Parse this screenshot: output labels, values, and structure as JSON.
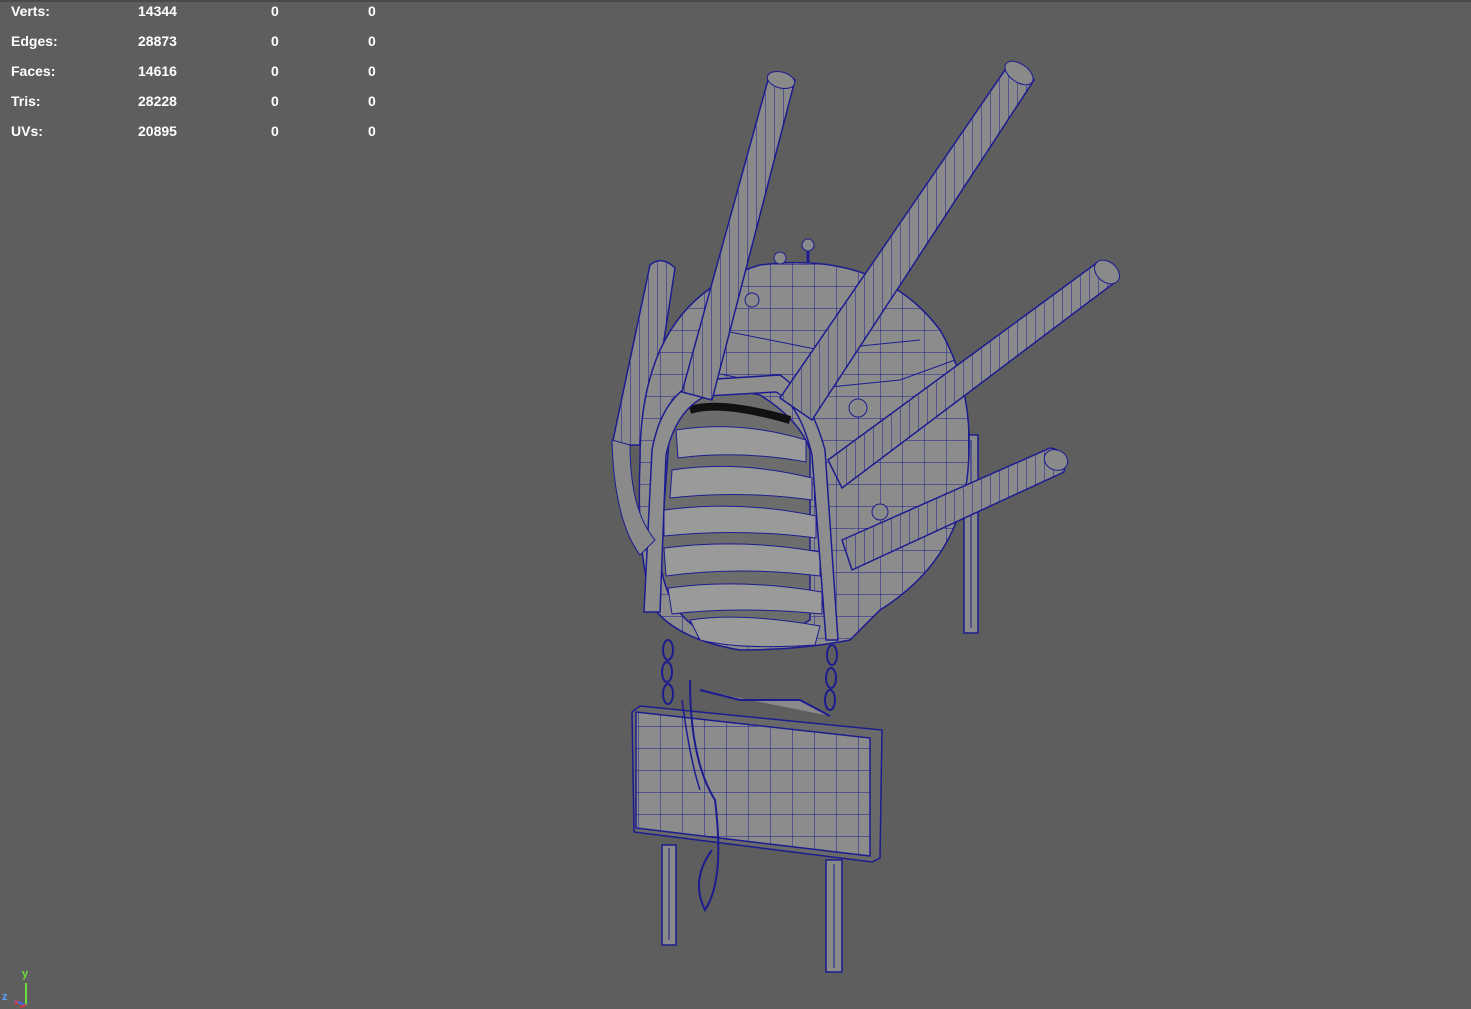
{
  "viewport": {
    "background": "#5e5e5e",
    "wire_color": "#1a1a8c",
    "shade_color": "#8a8a8a"
  },
  "hud": {
    "rows": [
      {
        "label": "Verts:",
        "c1": "14344",
        "c2": "0",
        "c3": "0"
      },
      {
        "label": "Edges:",
        "c1": "28873",
        "c2": "0",
        "c3": "0"
      },
      {
        "label": "Faces:",
        "c1": "14616",
        "c2": "0",
        "c3": "0"
      },
      {
        "label": "Tris:",
        "c1": "28228",
        "c2": "0",
        "c3": "0"
      },
      {
        "label": "UVs:",
        "c1": "20895",
        "c2": "0",
        "c3": "0"
      }
    ]
  },
  "axis": {
    "y": "y",
    "z": "z",
    "x": "x"
  }
}
